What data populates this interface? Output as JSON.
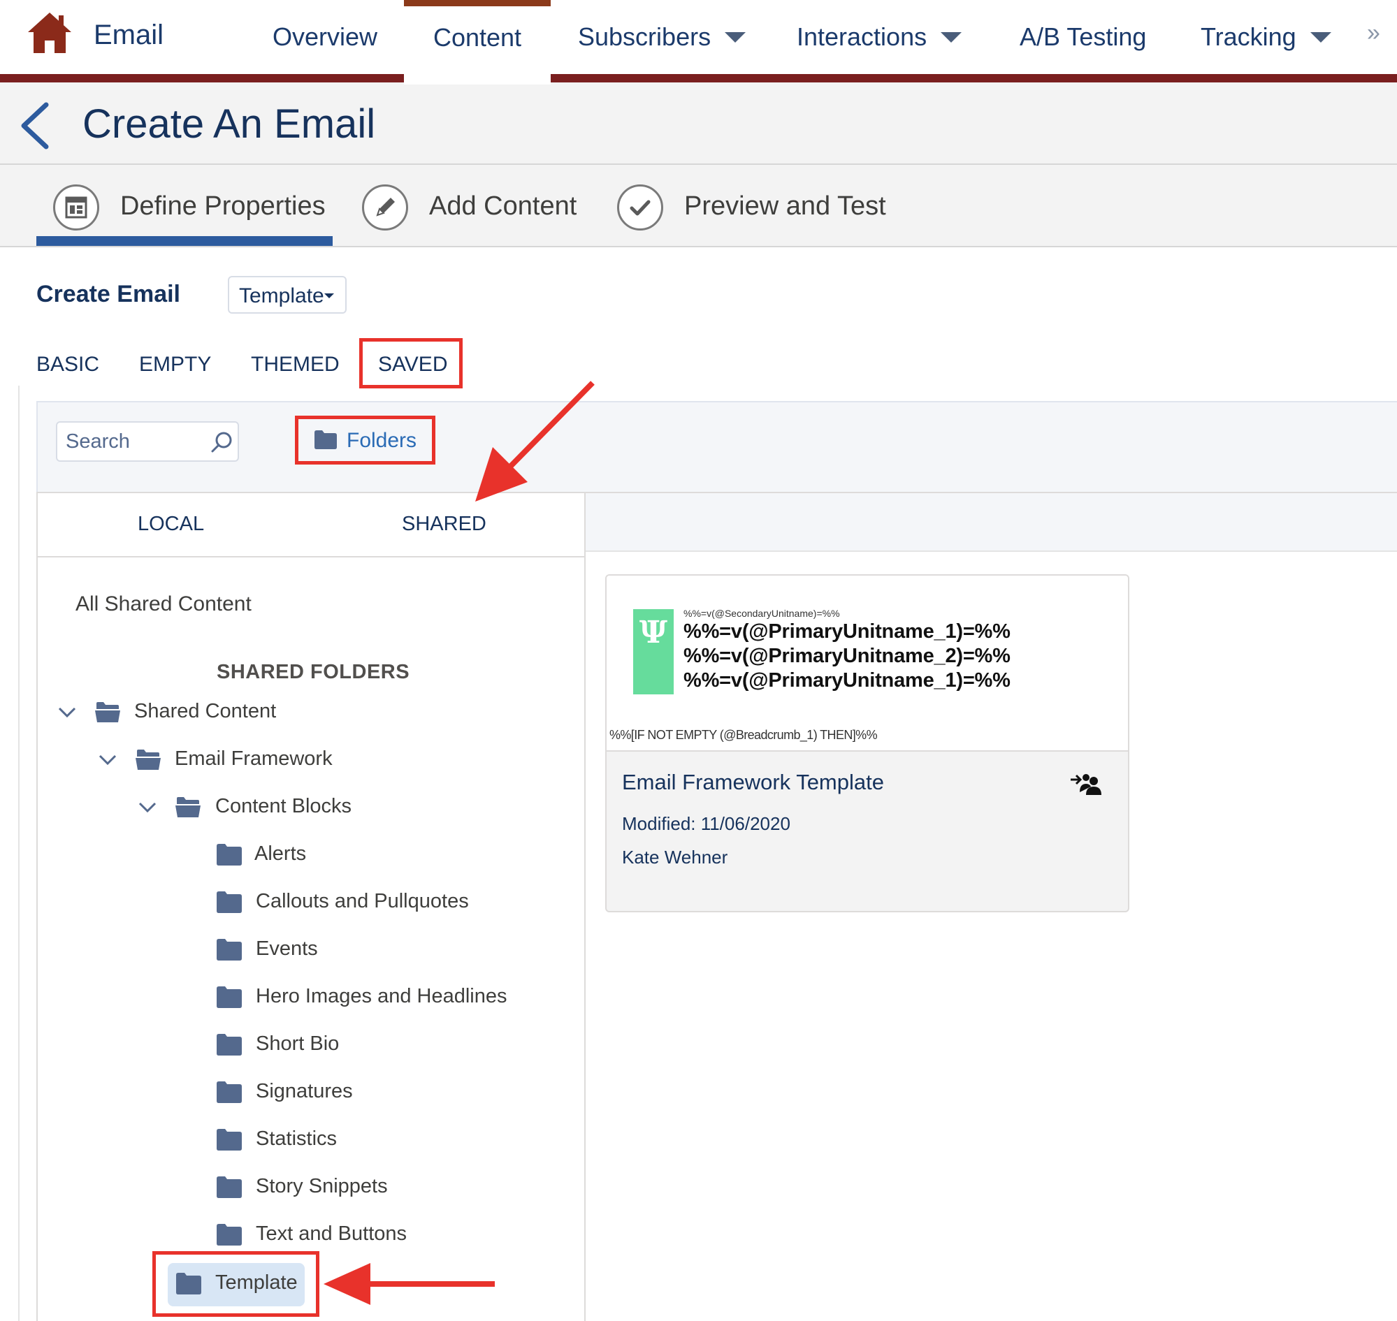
{
  "nav": {
    "app_name": "Email",
    "items": [
      {
        "label": "Overview"
      },
      {
        "label": "Content"
      },
      {
        "label": "Subscribers"
      },
      {
        "label": "Interactions"
      },
      {
        "label": "A/B Testing"
      },
      {
        "label": "Tracking"
      }
    ],
    "active": "Content",
    "more_glyph": "»"
  },
  "header": {
    "title": "Create An Email"
  },
  "steps": [
    {
      "label": "Define Properties",
      "icon": "properties-icon",
      "active": true
    },
    {
      "label": "Add Content",
      "icon": "pencil-icon"
    },
    {
      "label": "Preview and Test",
      "icon": "checkmark-icon"
    }
  ],
  "create": {
    "label": "Create Email",
    "dropdown_value": "Template"
  },
  "type_tabs": [
    "BASIC",
    "EMPTY",
    "THEMED",
    "SAVED"
  ],
  "toolbar": {
    "search_placeholder": "Search",
    "folders_label": "Folders"
  },
  "scope_tabs": [
    "LOCAL",
    "SHARED"
  ],
  "tree": {
    "all_label": "All Shared Content",
    "section_heading": "SHARED FOLDERS",
    "nodes": [
      {
        "label": "Shared Content"
      },
      {
        "label": "Email Framework"
      },
      {
        "label": "Content Blocks"
      },
      {
        "label": "Alerts"
      },
      {
        "label": "Callouts and Pullquotes"
      },
      {
        "label": "Events"
      },
      {
        "label": "Hero Images and Headlines"
      },
      {
        "label": "Short Bio"
      },
      {
        "label": "Signatures"
      },
      {
        "label": "Statistics"
      },
      {
        "label": "Story Snippets"
      },
      {
        "label": "Text and Buttons"
      },
      {
        "label": "Template"
      }
    ],
    "selected": "Template"
  },
  "card": {
    "preview": {
      "logo_glyph": "Ψ",
      "secondary_line": "%%=v(@SecondaryUnitname)=%%",
      "primary_lines": [
        "%%=v(@PrimaryUnitname_1)=%%",
        "%%=v(@PrimaryUnitname_2)=%%",
        "%%=v(@PrimaryUnitname_1)=%%"
      ],
      "bottom_line": "%%[IF NOT EMPTY (@Breadcrumb_1) THEN]%%"
    },
    "title": "Email Framework Template",
    "modified": "Modified: 11/06/2020",
    "author": "Kate Wehner"
  },
  "colors": {
    "brand_red": "#7a1f1f",
    "highlight": "#e8322b",
    "active_step": "#2d5b9e",
    "selected_folder": "#d8e6f5",
    "logo_green": "#66dc9c"
  }
}
